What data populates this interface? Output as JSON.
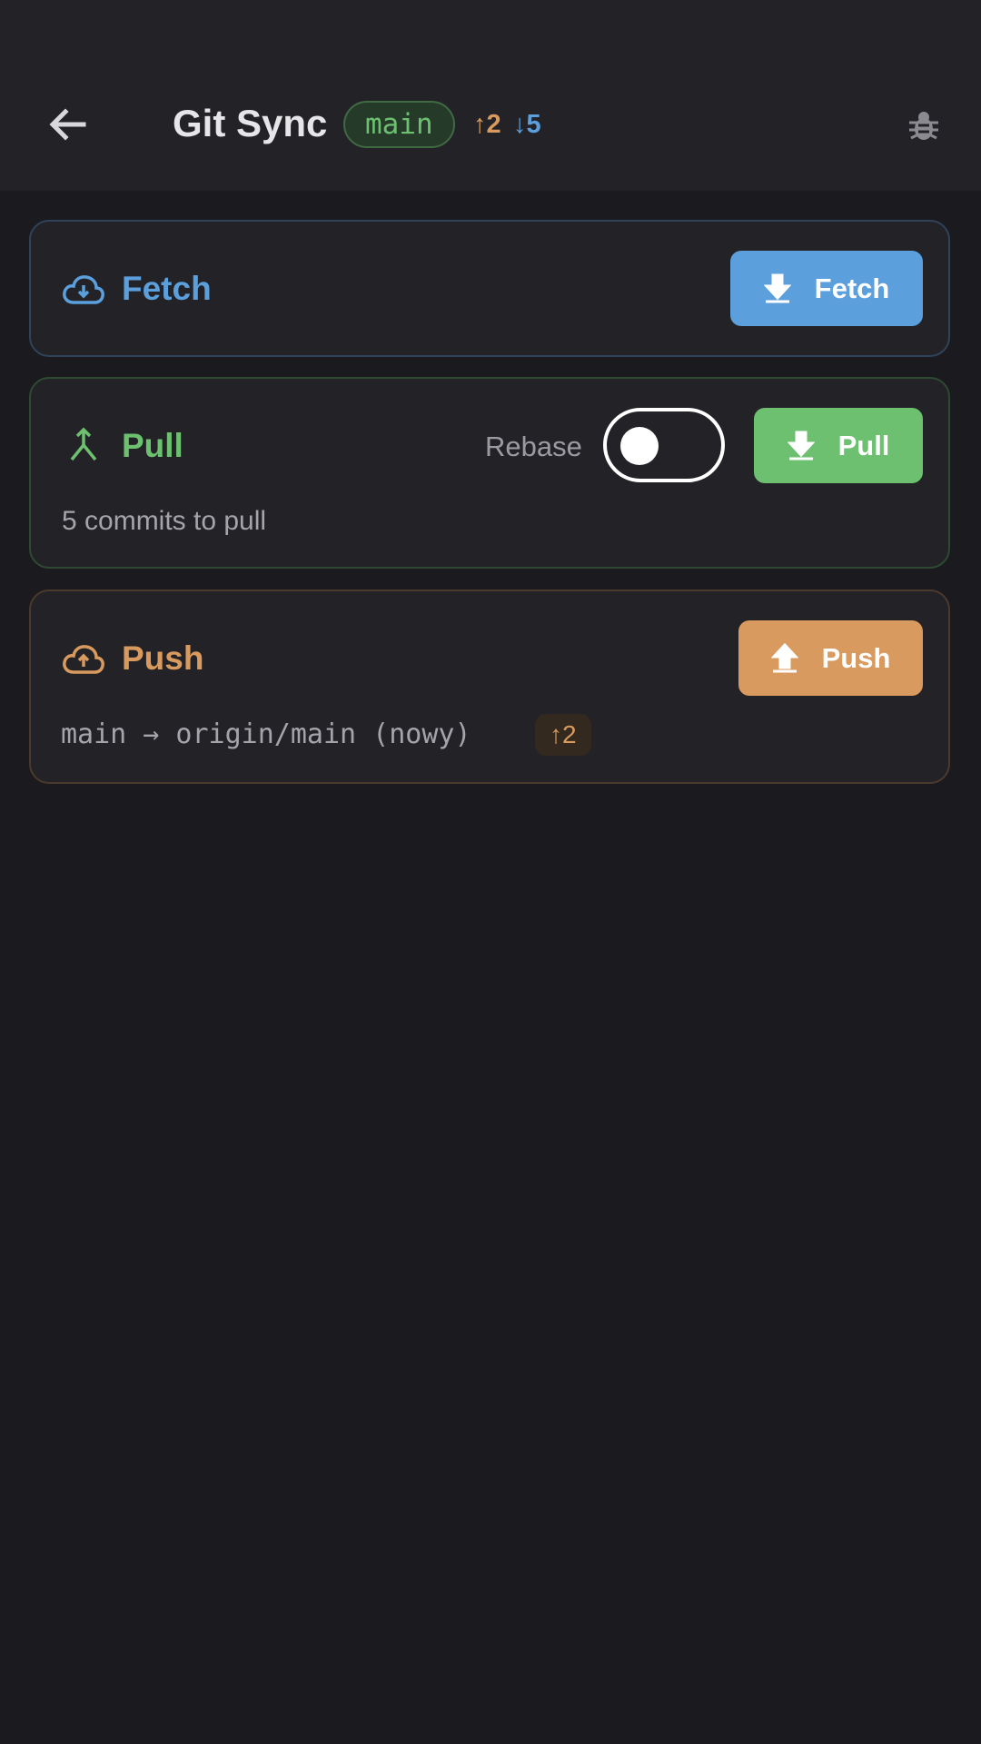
{
  "app": {
    "title": "Git Sync",
    "branch": "main",
    "ahead": "↑2",
    "behind": "↓5",
    "icons": {
      "back": "arrow-back-icon",
      "debug": "bug-icon"
    }
  },
  "colors": {
    "fetch": "#5b9fdc",
    "pull": "#6cc070",
    "push": "#d89a5e",
    "background": "#1b1b1f",
    "card": "#232327"
  },
  "fetch": {
    "title": "Fetch",
    "button_label": "Fetch",
    "icon": "cloud-download-icon",
    "button_icon": "download-icon"
  },
  "pull": {
    "title": "Pull",
    "rebase_label": "Rebase",
    "rebase_enabled": false,
    "button_label": "Pull",
    "info": "5 commits to pull",
    "icon": "merge-icon",
    "button_icon": "download-icon"
  },
  "push": {
    "title": "Push",
    "button_label": "Push",
    "info": "main → origin/main (nowy)",
    "ahead": "↑2",
    "icon": "cloud-upload-icon",
    "button_icon": "upload-icon"
  }
}
